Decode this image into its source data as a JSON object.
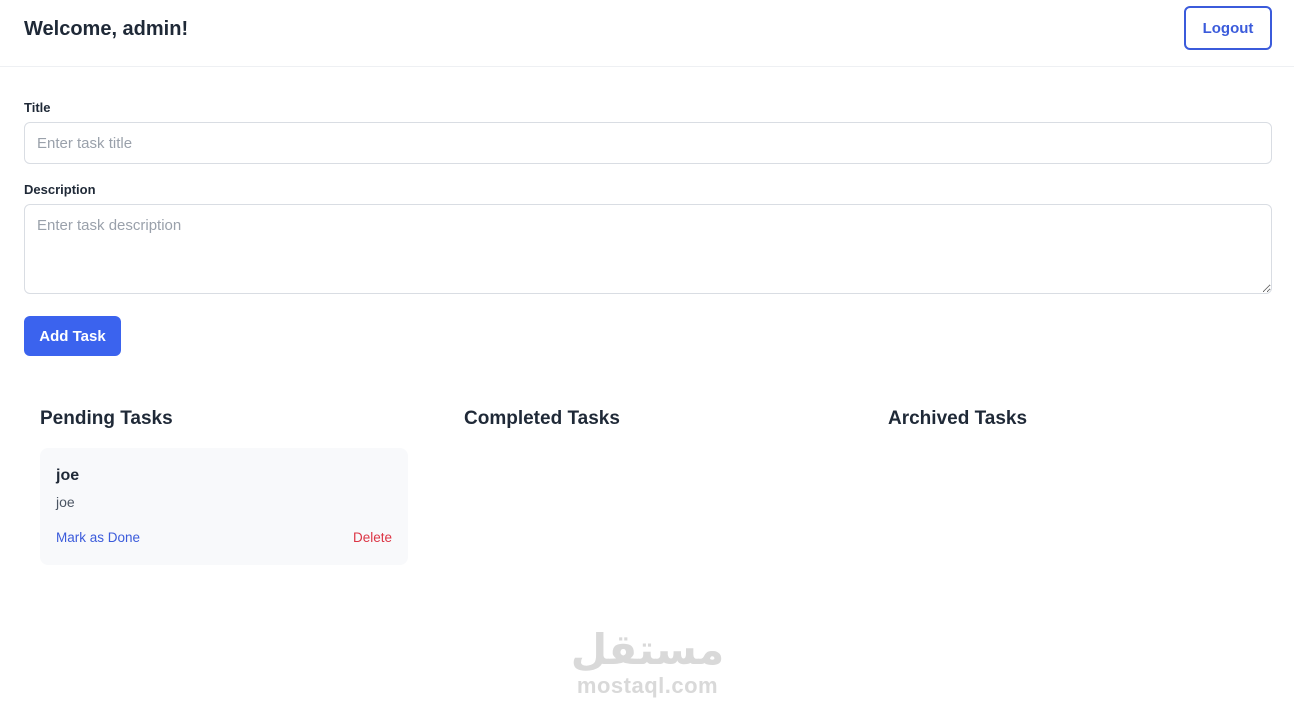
{
  "header": {
    "welcome": "Welcome, admin!",
    "logout_label": "Logout"
  },
  "form": {
    "title_label": "Title",
    "title_placeholder": "Enter task title",
    "title_value": "",
    "description_label": "Description",
    "description_placeholder": "Enter task description",
    "description_value": "",
    "add_button": "Add Task"
  },
  "columns": [
    {
      "title": "Pending Tasks",
      "tasks": [
        {
          "title": "joe",
          "description": "joe",
          "done_action": "Mark as Done",
          "delete_action": "Delete"
        }
      ]
    },
    {
      "title": "Completed Tasks",
      "tasks": []
    },
    {
      "title": "Archived Tasks",
      "tasks": []
    }
  ],
  "watermark": {
    "arabic": "مستقل",
    "latin": "mostaql.com"
  },
  "colors": {
    "accent": "#3b63ee",
    "delete": "#dc3545",
    "card_bg": "#f8f9fb"
  }
}
